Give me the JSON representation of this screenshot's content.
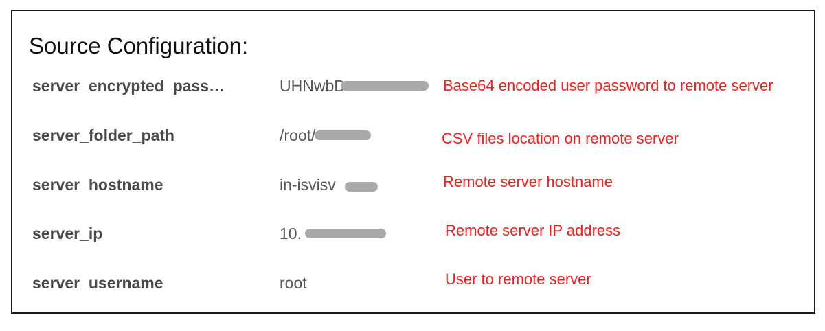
{
  "config": {
    "title": "Source Configuration:",
    "rows": [
      {
        "key": "server_encrypted_pass…",
        "value": "UHNwbD",
        "note": "Base64 encoded user password to remote server"
      },
      {
        "key": "server_folder_path",
        "value": "/root/",
        "note": "CSV files location on remote server"
      },
      {
        "key": "server_hostname",
        "value": "in-isvisv",
        "note": "Remote server hostname"
      },
      {
        "key": "server_ip",
        "value": "10.",
        "note": "Remote server IP address"
      },
      {
        "key": "server_username",
        "value": "root",
        "note": "User to remote server"
      }
    ],
    "colors": {
      "note_color": "#ff1a1a",
      "redaction_color": "#a9a9a9"
    }
  }
}
